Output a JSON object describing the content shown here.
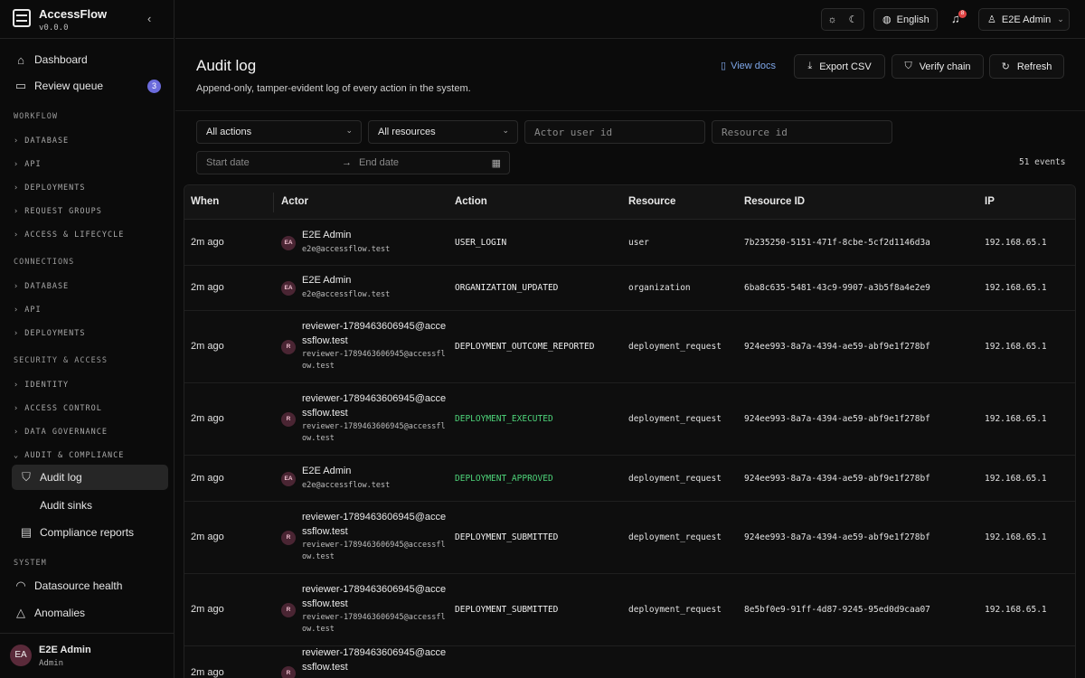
{
  "app": {
    "name": "AccessFlow",
    "version": "v0.0.0",
    "collapse_icon": "chevron-left-icon"
  },
  "sidebar": {
    "top_items": [
      {
        "label": "Dashboard",
        "icon": "home-icon"
      },
      {
        "label": "Review queue",
        "icon": "inbox-icon",
        "badge": "3"
      }
    ],
    "sections": {
      "workflow": "WORKFLOW",
      "connections": "CONNECTIONS",
      "security": "SECURITY & ACCESS",
      "system": "SYSTEM"
    },
    "workflow_groups": [
      "› DATABASE",
      "› API",
      "› DEPLOYMENTS",
      "› REQUEST GROUPS",
      "› ACCESS & LIFECYCLE"
    ],
    "connection_groups": [
      "› DATABASE",
      "› API",
      "› DEPLOYMENTS"
    ],
    "security_groups": [
      "› IDENTITY",
      "› ACCESS CONTROL",
      "› DATA GOVERNANCE",
      "⌄ AUDIT & COMPLIANCE"
    ],
    "audit_items": [
      {
        "label": "Audit log",
        "icon": "shield-icon",
        "active": true
      },
      {
        "label": "Audit sinks",
        "icon": "sink-icon"
      },
      {
        "label": "Compliance reports",
        "icon": "report-icon"
      }
    ],
    "system_items": [
      {
        "label": "Datasource health",
        "icon": "health-icon"
      },
      {
        "label": "Anomalies",
        "icon": "warning-icon"
      }
    ],
    "user": {
      "initials": "EA",
      "name": "E2E Admin",
      "role": "Admin"
    }
  },
  "topbar": {
    "language": "English",
    "notifications": "8",
    "user": "E2E Admin"
  },
  "header": {
    "title": "Audit log",
    "subtitle": "Append-only, tamper-evident log of every action in the system.",
    "view_docs": "View docs",
    "export": "Export CSV",
    "verify": "Verify chain",
    "refresh": "Refresh"
  },
  "filters": {
    "actions": "All actions",
    "resources": "All resources",
    "actor_placeholder": "Actor user id",
    "resource_placeholder": "Resource id",
    "start_placeholder": "Start date",
    "end_placeholder": "End date",
    "count": "51 events"
  },
  "table": {
    "columns": [
      "When",
      "Actor",
      "Action",
      "Resource",
      "Resource ID",
      "IP"
    ],
    "rows": [
      {
        "when": "2m ago",
        "initials": "EA",
        "name": "E2E Admin",
        "email": "e2e@accessflow.test",
        "action": "USER_LOGIN",
        "action_color": "#f0f0f0",
        "resource": "user",
        "resource_id": "7b235250-5151-471f-8cbe-5cf2d1146d3a",
        "ip": "192.168.65.1"
      },
      {
        "when": "2m ago",
        "initials": "EA",
        "name": "E2E Admin",
        "email": "e2e@accessflow.test",
        "action": "ORGANIZATION_UPDATED",
        "action_color": "#f0f0f0",
        "resource": "organization",
        "resource_id": "6ba8c635-5481-43c9-9907-a3b5f8a4e2e9",
        "ip": "192.168.65.1"
      },
      {
        "when": "2m ago",
        "initials": "R",
        "name": "reviewer-1789463606945@accessflow.test",
        "email": "reviewer-1789463606945@accessflow.test",
        "action": "DEPLOYMENT_OUTCOME_REPORTED",
        "action_color": "#f0f0f0",
        "resource": "deployment_request",
        "resource_id": "924ee993-8a7a-4394-ae59-abf9e1f278bf",
        "ip": "192.168.65.1"
      },
      {
        "when": "2m ago",
        "initials": "R",
        "name": "reviewer-1789463606945@accessflow.test",
        "email": "reviewer-1789463606945@accessflow.test",
        "action": "DEPLOYMENT_EXECUTED",
        "action_color": "#4ed47a",
        "resource": "deployment_request",
        "resource_id": "924ee993-8a7a-4394-ae59-abf9e1f278bf",
        "ip": "192.168.65.1"
      },
      {
        "when": "2m ago",
        "initials": "EA",
        "name": "E2E Admin",
        "email": "e2e@accessflow.test",
        "action": "DEPLOYMENT_APPROVED",
        "action_color": "#4ed47a",
        "resource": "deployment_request",
        "resource_id": "924ee993-8a7a-4394-ae59-abf9e1f278bf",
        "ip": "192.168.65.1"
      },
      {
        "when": "2m ago",
        "initials": "R",
        "name": "reviewer-1789463606945@accessflow.test",
        "email": "reviewer-1789463606945@accessflow.test",
        "action": "DEPLOYMENT_SUBMITTED",
        "action_color": "#f0f0f0",
        "resource": "deployment_request",
        "resource_id": "924ee993-8a7a-4394-ae59-abf9e1f278bf",
        "ip": "192.168.65.1"
      },
      {
        "when": "2m ago",
        "initials": "R",
        "name": "reviewer-1789463606945@accessflow.test",
        "email": "reviewer-1789463606945@accessflow.test",
        "action": "DEPLOYMENT_SUBMITTED",
        "action_color": "#f0f0f0",
        "resource": "deployment_request",
        "resource_id": "8e5bf0e9-91ff-4d87-9245-95ed0d9caa07",
        "ip": "192.168.65.1"
      },
      {
        "when": "2m ago",
        "initials": "R",
        "name": "reviewer-1789463606945@accessflow.test",
        "email": "",
        "action": "",
        "action_color": "#f0f0f0",
        "resource": "",
        "resource_id": "",
        "ip": ""
      }
    ]
  }
}
